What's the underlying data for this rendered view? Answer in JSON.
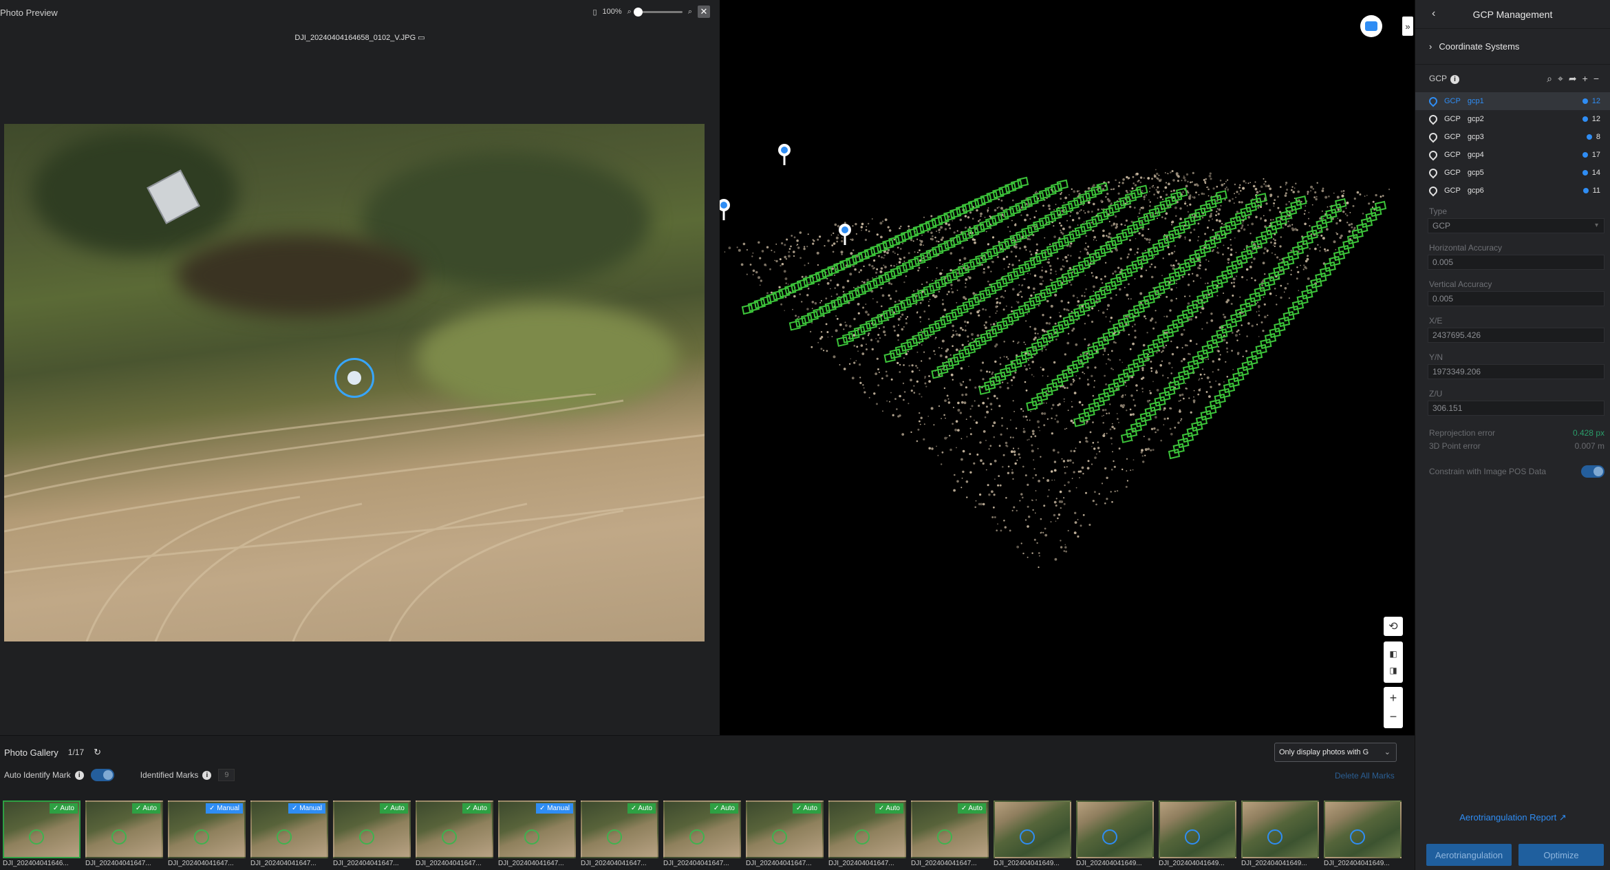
{
  "preview": {
    "title": "Photo Preview",
    "zoom_level": "100%",
    "filename": "DJI_20240404164658_0102_V.JPG",
    "close_label": "✕"
  },
  "viewer": {
    "expand_label": "»",
    "zoom_in_label": "+",
    "zoom_out_label": "−"
  },
  "panel": {
    "title": "GCP Management",
    "coord_section": "Coordinate Systems",
    "gcp_header": "GCP",
    "gcp_items": [
      {
        "type": "GCP",
        "name": "gcp1",
        "count": "12",
        "selected": true
      },
      {
        "type": "GCP",
        "name": "gcp2",
        "count": "12",
        "selected": false
      },
      {
        "type": "GCP",
        "name": "gcp3",
        "count": "8",
        "selected": false
      },
      {
        "type": "GCP",
        "name": "gcp4",
        "count": "17",
        "selected": false
      },
      {
        "type": "GCP",
        "name": "gcp5",
        "count": "14",
        "selected": false
      },
      {
        "type": "GCP",
        "name": "gcp6",
        "count": "11",
        "selected": false
      }
    ],
    "type_label": "Type",
    "type_value": "GCP",
    "h_acc_label": "Horizontal Accuracy",
    "h_acc_value": "0.005",
    "v_acc_label": "Vertical Accuracy",
    "v_acc_value": "0.005",
    "x_label": "X/E",
    "x_value": "2437695.426",
    "y_label": "Y/N",
    "y_value": "1973349.206",
    "z_label": "Z/U",
    "z_value": "306.151",
    "reproj_label": "Reprojection error",
    "reproj_value": "0.428 px",
    "point3d_label": "3D Point error",
    "point3d_value": "0.007 m",
    "constrain_label": "Constrain with Image POS Data",
    "report_link": "Aerotriangulation Report",
    "aerotri_button": "Aerotriangulation",
    "optimize_button": "Optimize"
  },
  "gallery": {
    "title": "Photo Gallery",
    "page": "1/17",
    "auto_identify_label": "Auto Identify Mark",
    "identified_label": "Identified Marks",
    "identified_count": "9",
    "filter_value": "Only display photos with G",
    "delete_all": "Delete All Marks",
    "thumbs": [
      {
        "caption": "DJI_202404041646...",
        "badge": "Auto",
        "kind": "auto",
        "forest": false,
        "selected": true
      },
      {
        "caption": "DJI_202404041647...",
        "badge": "Auto",
        "kind": "auto",
        "forest": false,
        "selected": false
      },
      {
        "caption": "DJI_202404041647...",
        "badge": "Manual",
        "kind": "manual",
        "forest": false,
        "selected": false
      },
      {
        "caption": "DJI_202404041647...",
        "badge": "Manual",
        "kind": "manual",
        "forest": false,
        "selected": false
      },
      {
        "caption": "DJI_202404041647...",
        "badge": "Auto",
        "kind": "auto",
        "forest": false,
        "selected": false
      },
      {
        "caption": "DJI_202404041647...",
        "badge": "Auto",
        "kind": "auto",
        "forest": false,
        "selected": false
      },
      {
        "caption": "DJI_202404041647...",
        "badge": "Manual",
        "kind": "manual",
        "forest": false,
        "selected": false
      },
      {
        "caption": "DJI_202404041647...",
        "badge": "Auto",
        "kind": "auto",
        "forest": false,
        "selected": false
      },
      {
        "caption": "DJI_202404041647...",
        "badge": "Auto",
        "kind": "auto",
        "forest": false,
        "selected": false
      },
      {
        "caption": "DJI_202404041647...",
        "badge": "Auto",
        "kind": "auto",
        "forest": false,
        "selected": false
      },
      {
        "caption": "DJI_202404041647...",
        "badge": "Auto",
        "kind": "auto",
        "forest": false,
        "selected": false
      },
      {
        "caption": "DJI_202404041647...",
        "badge": "Auto",
        "kind": "auto",
        "forest": false,
        "selected": false
      },
      {
        "caption": "DJI_202404041649...",
        "badge": "",
        "kind": "none",
        "forest": true,
        "selected": false
      },
      {
        "caption": "DJI_202404041649...",
        "badge": "",
        "kind": "none",
        "forest": true,
        "selected": false
      },
      {
        "caption": "DJI_202404041649...",
        "badge": "",
        "kind": "none",
        "forest": true,
        "selected": false
      },
      {
        "caption": "DJI_202404041649...",
        "badge": "",
        "kind": "none",
        "forest": true,
        "selected": false
      },
      {
        "caption": "DJI_202404041649...",
        "badge": "",
        "kind": "none",
        "forest": true,
        "selected": false
      }
    ]
  },
  "colors": {
    "accent": "#2f8df4",
    "auto_badge": "#2ea043",
    "point_green": "#3cc43a"
  }
}
